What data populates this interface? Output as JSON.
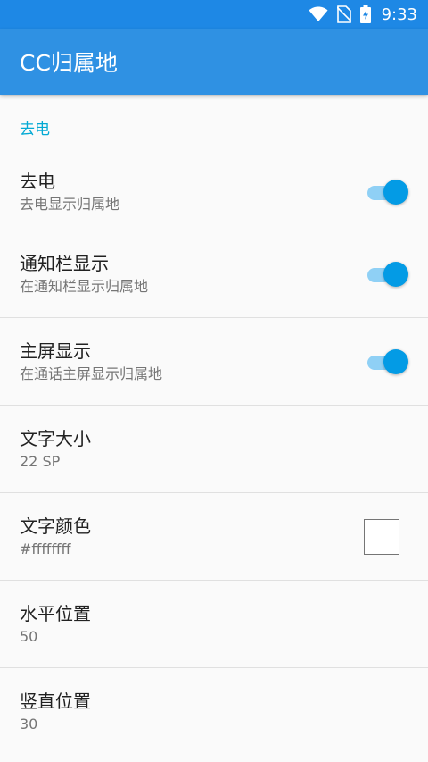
{
  "status_bar": {
    "time": "9:33",
    "icons": [
      "wifi-icon",
      "no-sim-icon",
      "battery-charging-icon"
    ]
  },
  "app_bar": {
    "title": "CC归属地"
  },
  "colors": {
    "status_bar": "#1e88e5",
    "app_bar": "#2f91e3",
    "accent": "#039be5",
    "category_text": "#03a9d4"
  },
  "category": {
    "title": "去电"
  },
  "prefs": [
    {
      "title": "去电",
      "summary": "去电显示归属地",
      "widget": "switch",
      "checked": true
    },
    {
      "title": "通知栏显示",
      "summary": "在通知栏显示归属地",
      "widget": "switch",
      "checked": true
    },
    {
      "title": "主屏显示",
      "summary": "在通话主屏显示归属地",
      "widget": "switch",
      "checked": true
    },
    {
      "title": "文字大小",
      "summary": "22 SP"
    },
    {
      "title": "文字颜色",
      "summary": "#ffffffff",
      "widget": "color-swatch",
      "swatch_color": "#ffffff"
    },
    {
      "title": "水平位置",
      "summary": "50"
    },
    {
      "title": "竖直位置",
      "summary": "30"
    }
  ]
}
